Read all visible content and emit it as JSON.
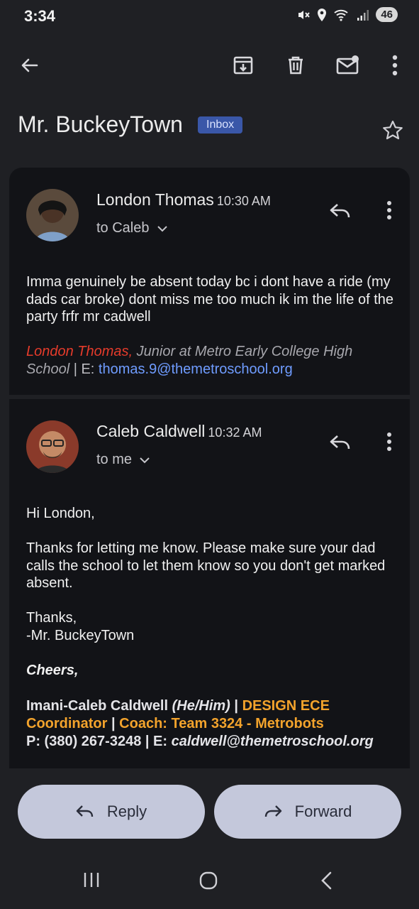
{
  "status": {
    "time": "3:34",
    "battery": "46"
  },
  "subject": {
    "title": "Mr. BuckeyTown",
    "label": "Inbox"
  },
  "messages": [
    {
      "sender": "London Thomas",
      "time": "10:30 AM",
      "to": "to Caleb",
      "body": "Imma genuinely be absent today bc i dont have a ride (my dads car broke) dont miss me too much ik im the life of the party frfr mr cadwell",
      "signature": {
        "name": "London Thomas,",
        "title": " Junior at Metro Early College High School",
        "sep": " | E: ",
        "email": "thomas.9@themetroschool.org"
      }
    },
    {
      "sender": "Caleb Caldwell",
      "time": "10:32 AM",
      "to": "to me",
      "greeting": "Hi London,",
      "body": "Thanks for letting me know. Please make sure your dad calls the school to let them know so you don't get marked absent.",
      "closing1": "Thanks,",
      "closing2": "-Mr. BuckeyTown",
      "cheers": "Cheers,",
      "signature": {
        "name": "Imani-Caleb Caldwell ",
        "pronouns": "(He/Him)",
        "sep1": " | ",
        "role": "DESIGN ECE Coordinator",
        "sep2": " | ",
        "coach": "Coach: Team 3324 - Metrobots",
        "phone": "P: (380) 267-3248 | E: ",
        "email": "caldwell@themetroschool.org"
      }
    }
  ],
  "actions": {
    "reply": "Reply",
    "forward": "Forward"
  },
  "icons": {
    "back": "arrow-left-icon",
    "archive": "archive-icon",
    "delete": "trash-icon",
    "unread": "mark-unread-icon",
    "more": "more-vert-icon",
    "star": "star-icon",
    "reply": "reply-icon",
    "forward": "forward-icon"
  },
  "colors": {
    "background": "#1f2024",
    "card": "#121317",
    "badge": "#3a57a8",
    "link": "#6f9cff",
    "red": "#e53b2b",
    "orange": "#f3a32c",
    "button": "#c4c8db"
  }
}
